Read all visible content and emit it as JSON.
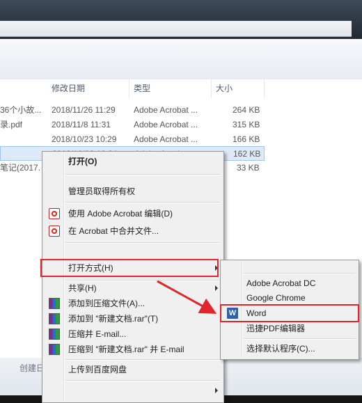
{
  "columns": {
    "date": "修改日期",
    "type": "类型",
    "size": "大小"
  },
  "files": [
    {
      "name": "36个小故...",
      "date": "2018/11/26 11:29",
      "type": "Adobe Acrobat ...",
      "size": "264 KB"
    },
    {
      "name": "录.pdf",
      "date": "2018/11/8 11:31",
      "type": "Adobe Acrobat ...",
      "size": "315 KB"
    },
    {
      "name": "",
      "date": "2018/10/23 10:29",
      "type": "Adobe Acrobat ...",
      "size": "166 KB"
    },
    {
      "name": "",
      "date": "2018/10/23 10:24",
      "type": "Adobe Acrobat ...",
      "size": "162 KB"
    },
    {
      "name": "笔记(2017...",
      "date": "",
      "type": "",
      "size": "33 KB"
    }
  ],
  "status": {
    "created_label": "创建日"
  },
  "context_menu": {
    "open": "打开(O)",
    "take_ownership": "管理员取得所有权",
    "edit_acrobat": "使用 Adobe Acrobat 编辑(D)",
    "combine_acrobat": "在 Acrobat 中合并文件...",
    "open_with": "打开方式(H)",
    "share": "共享(H)",
    "add_archive": "添加到压缩文件(A)...",
    "add_rar": "添加到 \"新建文档.rar\"(T)",
    "compress_email": "压缩并 E-mail...",
    "compress_rar_email": "压缩到 \"新建文档.rar\" 并 E-mail",
    "upload_baidu": "上传到百度网盘"
  },
  "submenu": {
    "acrobat_dc": "Adobe Acrobat DC",
    "chrome": "Google Chrome",
    "word": "Word",
    "xunjie_pdf": "迅捷PDF编辑器",
    "choose_default": "选择默认程序(C)..."
  },
  "colors": {
    "highlight_red": "#e0262c",
    "selection_blue": "#dbe9f8"
  }
}
